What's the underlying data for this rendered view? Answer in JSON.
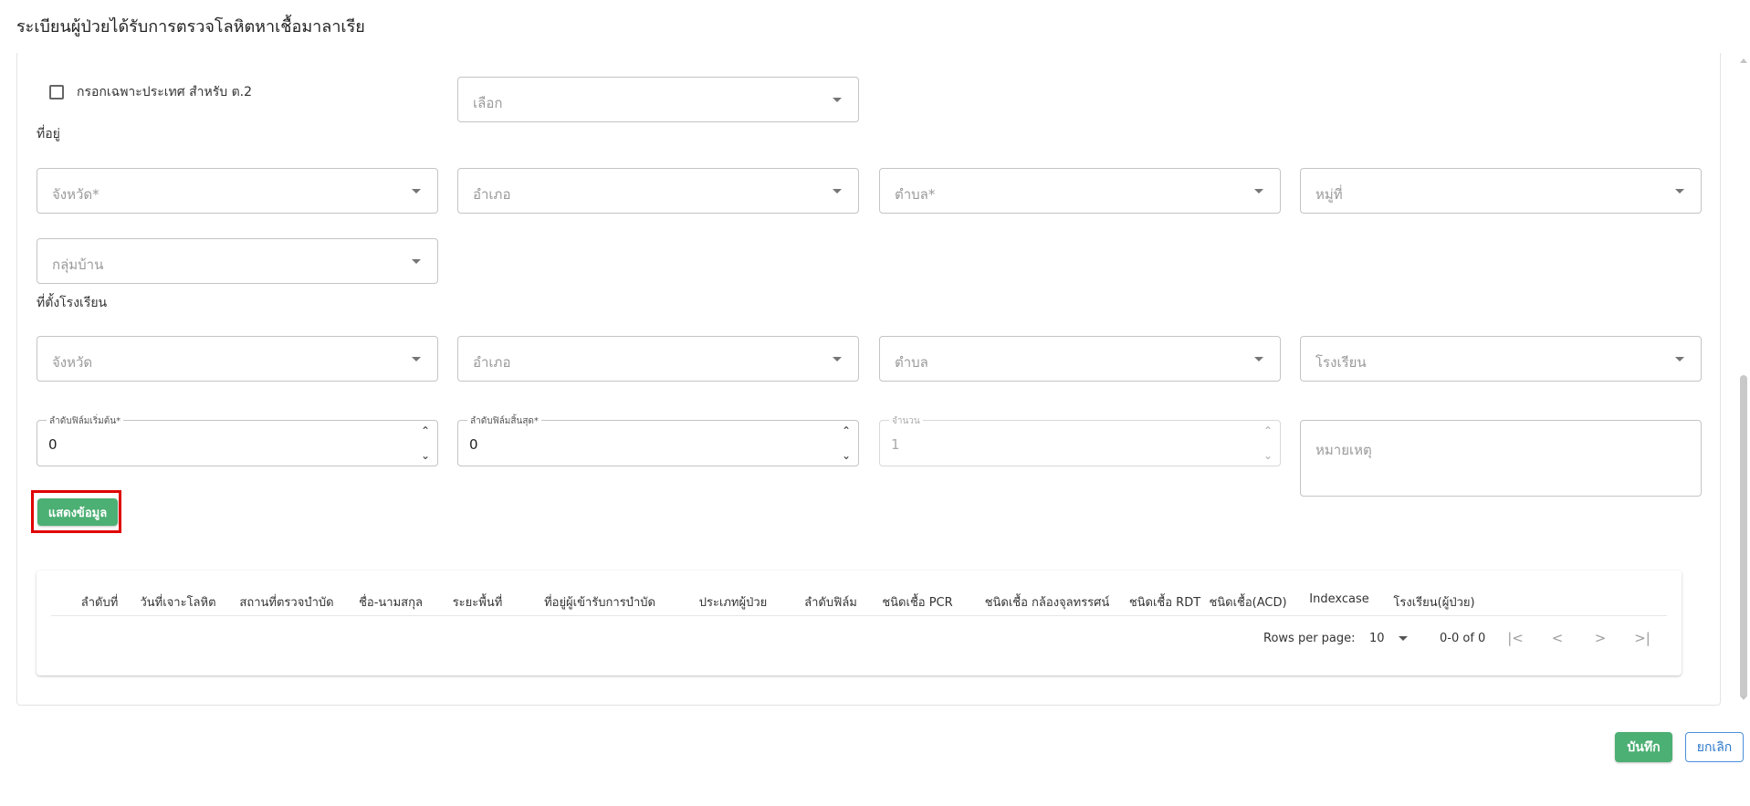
{
  "page": {
    "title": "ระเบียนผู้ป่วยได้รับการตรวจโลหิตหาเชื้อมาลาเรีย"
  },
  "country_filter": {
    "checkbox_label": "กรอกเฉพาะประเทศ สำหรับ ต.2",
    "checked": false,
    "select_placeholder": "เลือก"
  },
  "address": {
    "section_label": "ที่อยู่",
    "province": "จังหวัด*",
    "district": "อำเภอ",
    "subdistrict": "ตำบล*",
    "village": "หมู่ที่",
    "village_group": "กลุ่มบ้าน"
  },
  "school_location": {
    "section_label": "ที่ตั้งโรงเรียน",
    "province": "จังหวัด",
    "district": "อำเภอ",
    "subdistrict": "ตำบล",
    "school": "โรงเรียน"
  },
  "film": {
    "start_label": "ลำดับฟิล์มเริ่มต้น*",
    "start_value": "0",
    "end_label": "ลำดับฟิล์มสิ้นสุด*",
    "end_value": "0",
    "count_label": "จำนวน",
    "count_value": "1",
    "remark_placeholder": "หมายเหตุ"
  },
  "spin_icons": {
    "up": "⌃",
    "down": "⌄"
  },
  "actions": {
    "show_data": "แสดงข้อมูล",
    "save": "บันทึก",
    "cancel": "ยกเลิก"
  },
  "table": {
    "columns": [
      "ลำดับที่",
      "วันที่เจาะโลหิต",
      "สถานที่ตรวจบำบัด",
      "ชื่อ-นามสกุล",
      "ระยะพื้นที่",
      "ที่อยู่ผู้เข้ารับการบำบัด",
      "ประเภทผู้ป่วย",
      "ลำดับฟิล์ม",
      "ชนิดเชื้อ PCR",
      "ชนิดเชื้อ กล้องจุลทรรศน์",
      "ชนิดเชื้อ RDT",
      "ชนิดเชื้อ(ACD)",
      "Indexcase",
      "โรงเรียน(ผู้ป่วย)"
    ],
    "rows": []
  },
  "pagination": {
    "rows_per_page_label": "Rows per page:",
    "rows_per_page_value": "10",
    "range": "0-0 of 0",
    "first_icon": "|<",
    "prev_icon": "<",
    "next_icon": ">",
    "last_icon": ">|"
  },
  "colors": {
    "primary_green": "#4caf73",
    "highlight_red": "#e00000",
    "cancel_blue": "#2a77c9"
  }
}
